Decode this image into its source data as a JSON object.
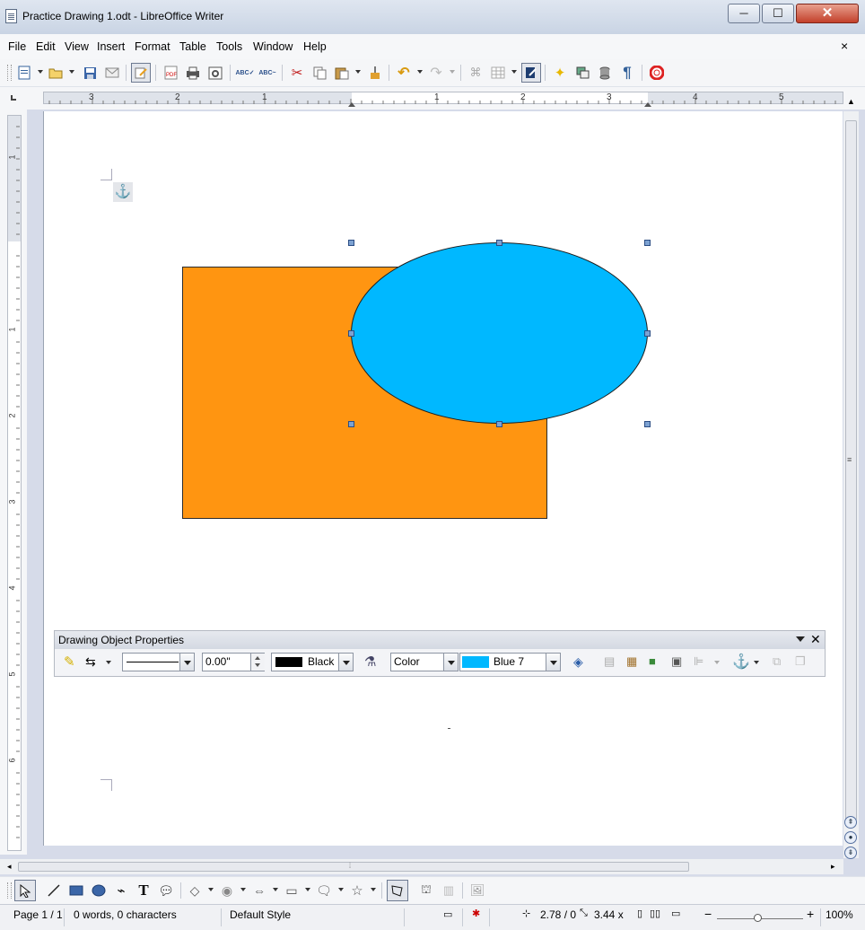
{
  "window": {
    "title": "Practice Drawing 1.odt - LibreOffice Writer",
    "minimize": "─",
    "maximize": "☐",
    "close": "✕"
  },
  "menu": [
    "File",
    "Edit",
    "View",
    "Insert",
    "Format",
    "Table",
    "Tools",
    "Window",
    "Help"
  ],
  "menu_close": "×",
  "hruler_numbers": [
    "3",
    "2",
    "1",
    "1",
    "2",
    "3",
    "4",
    "5"
  ],
  "vruler_numbers": [
    "1",
    "1",
    "2",
    "3",
    "4",
    "5",
    "6"
  ],
  "drawing_properties": {
    "title": "Drawing Object Properties",
    "line_width": "0.00\"",
    "line_color_name": "Black",
    "line_color": "#000000",
    "area_style": "Color",
    "area_color_name": "Blue 7",
    "area_color": "#00b8ff"
  },
  "shapes": {
    "rectangle_color": "#ff9511",
    "ellipse_color": "#00b8ff"
  },
  "status": {
    "page": "Page 1 / 1",
    "words": "0 words, 0 characters",
    "style": "Default Style",
    "position": "2.78 / 0",
    "size": "3.44 x",
    "zoom": "100%"
  },
  "icons": {
    "toolbar": [
      "new-icon",
      "open-icon",
      "save-icon",
      "email-icon",
      "edit-mode-icon",
      "export-pdf-icon",
      "print-icon",
      "print-preview-icon",
      "spellcheck-icon",
      "autospell-icon",
      "cut-icon",
      "copy-icon",
      "paste-icon",
      "clone-formatting-icon",
      "undo-icon",
      "redo-icon",
      "hyperlink-icon",
      "table-icon",
      "show-draw-functions-icon",
      "navigator-icon",
      "gallery-icon",
      "data-sources-icon",
      "formatting-marks-icon",
      "help-icon"
    ],
    "draw": [
      "select-icon",
      "line-icon",
      "rectangle-icon",
      "ellipse-icon",
      "curve-icon",
      "text-icon",
      "callout-icon",
      "basic-shapes-icon",
      "symbol-shapes-icon",
      "block-arrows-icon",
      "flowchart-icon",
      "callouts-icon",
      "stars-icon",
      "points-icon",
      "fontwork-icon",
      "extrusion-icon",
      "from-file-icon"
    ]
  }
}
